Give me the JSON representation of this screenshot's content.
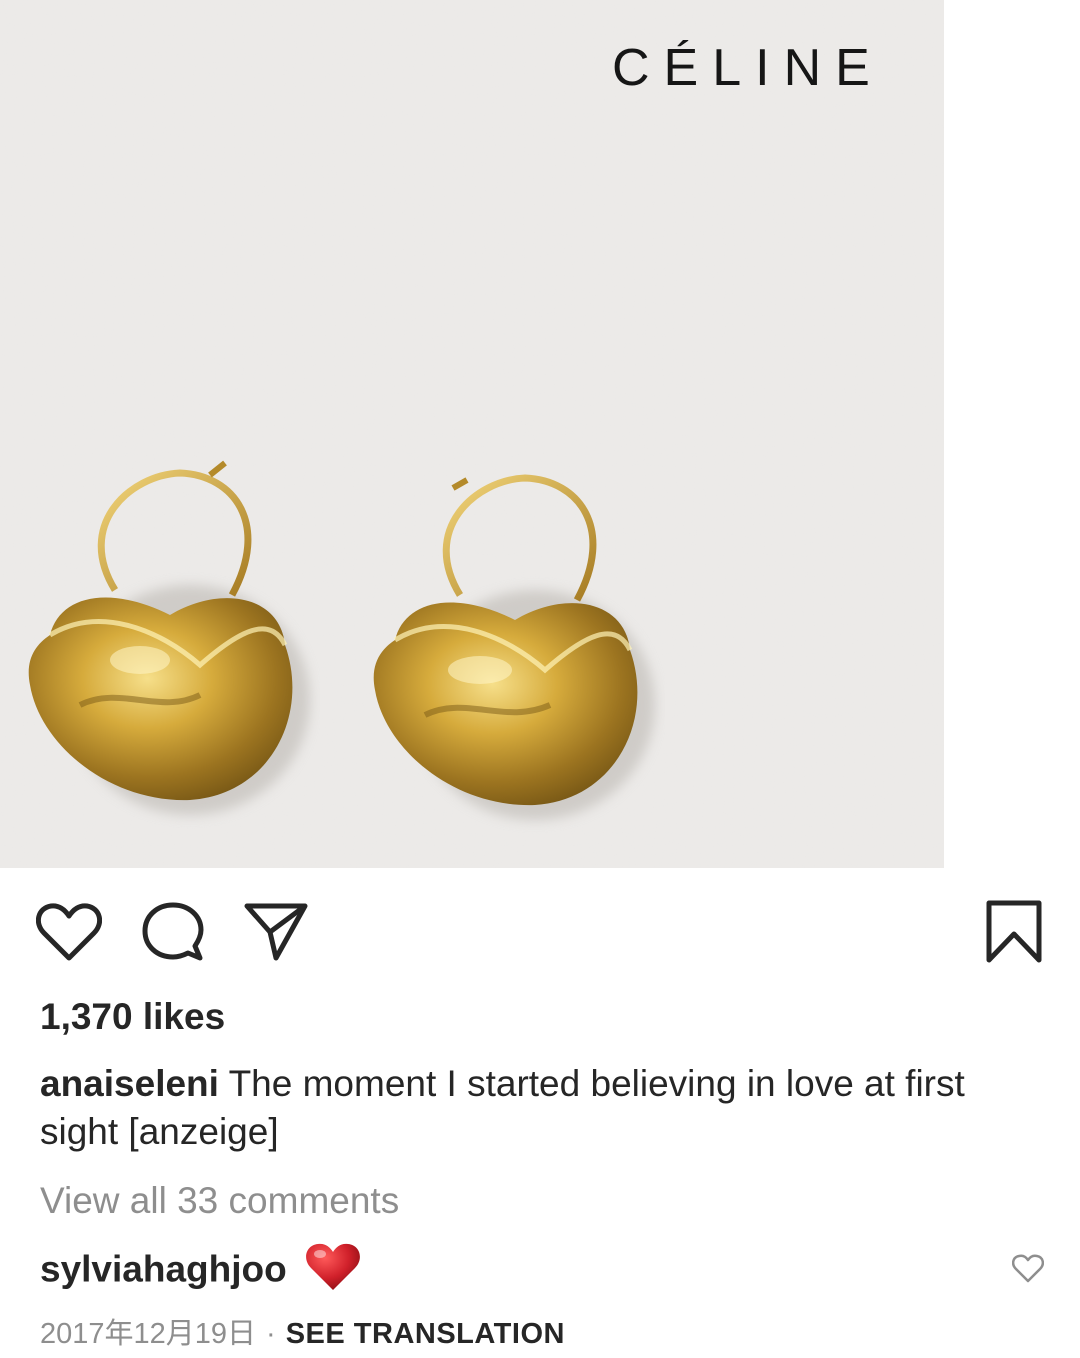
{
  "post": {
    "brand_logo": "CÉLINE",
    "likes": "1,370 likes",
    "caption": {
      "username": "anaiseleni",
      "text": "The moment I started believing in love at first sight [anzeige]"
    },
    "view_comments": "View all 33 comments",
    "comment": {
      "username": "sylviahaghjoo",
      "emoji": "heart"
    },
    "date": "2017年12月19日",
    "separator": "·",
    "see_translation": "SEE TRANSLATION"
  },
  "icons": {
    "like": "heart-icon",
    "comment": "comment-icon",
    "share": "paper-plane-icon",
    "save": "bookmark-icon",
    "comment_like": "heart-icon"
  },
  "colors": {
    "text": "#262626",
    "muted": "#8e8e8e",
    "heart_red": "#d0202a",
    "gold": "#c9a13a",
    "backdrop": "#e9e7e5"
  }
}
